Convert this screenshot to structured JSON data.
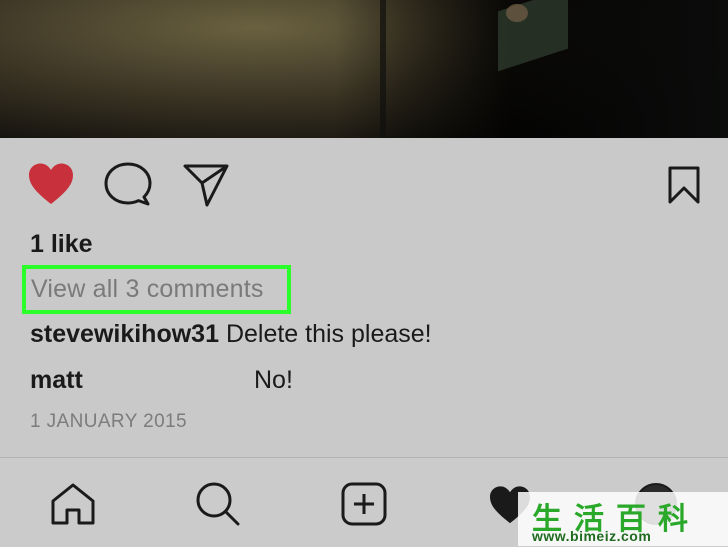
{
  "post": {
    "likes_text": "1 like",
    "view_all_comments": "View all 3 comments",
    "comments": [
      {
        "user": "stevewikihow31",
        "text": "Delete this please!"
      },
      {
        "user": "matt",
        "text": "No!"
      }
    ],
    "date": "1 JANUARY 2015"
  },
  "actions": {
    "like_icon": "heart-filled-icon",
    "comment_icon": "speech-bubble-icon",
    "share_icon": "paper-plane-icon",
    "save_icon": "bookmark-icon",
    "like_color": "#c8313b"
  },
  "tabbar": {
    "items": [
      "home-icon",
      "search-icon",
      "add-post-icon",
      "activity-heart-icon",
      "profile-icon"
    ]
  },
  "watermark": {
    "title": "生活百科",
    "url": "www.bimeiz.com"
  },
  "colors": {
    "highlight": "#2aff2a",
    "background": "#c9c9c9"
  }
}
